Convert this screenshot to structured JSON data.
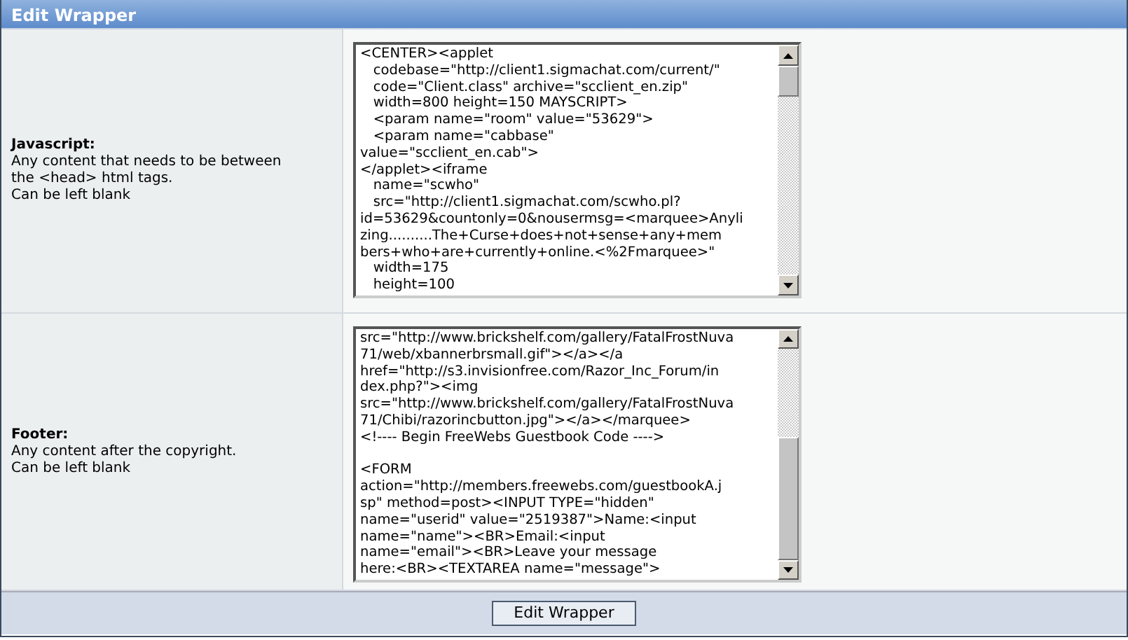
{
  "header": {
    "title": "Edit Wrapper"
  },
  "fields": [
    {
      "label": "Javascript:",
      "description": "Any content that needs to be between\nthe <head> html tags.\nCan be left blank",
      "value": "<CENTER><applet\n   codebase=\"http://client1.sigmachat.com/current/\"\n   code=\"Client.class\" archive=\"scclient_en.zip\"\n   width=800 height=150 MAYSCRIPT>\n   <param name=\"room\" value=\"53629\">\n   <param name=\"cabbase\"\nvalue=\"scclient_en.cab\">\n</applet><iframe\n   name=\"scwho\"\n   src=\"http://client1.sigmachat.com/scwho.pl?\nid=53629&countonly=0&nousermsg=<marquee>Anyli\nzing..........The+Curse+does+not+sense+any+mem\nbers+who+are+currently+online.<%2Fmarquee>\"\n   width=175\n   height=100"
    },
    {
      "label": "Footer:",
      "description": "Any content after the copyright.\nCan be left blank",
      "value": "src=\"http://www.brickshelf.com/gallery/FatalFrostNuva\n71/web/xbannerbrsmall.gif\"></a></a\nhref=\"http://s3.invisionfree.com/Razor_Inc_Forum/in\ndex.php?\"><img\nsrc=\"http://www.brickshelf.com/gallery/FatalFrostNuva\n71/Chibi/razorincbutton.jpg\"></a></marquee>\n<!---- Begin FreeWebs Guestbook Code ---->\n\n<FORM\naction=\"http://members.freewebs.com/guestbookA.j\nsp\" method=post><INPUT TYPE=\"hidden\"\nname=\"userid\" value=\"2519387\">Name:<input\nname=\"name\"><BR>Email:<input\nname=\"email\"><BR>Leave your message\nhere:<BR><TEXTAREA name=\"message\">"
    }
  ],
  "submit": {
    "label": "Edit Wrapper"
  }
}
